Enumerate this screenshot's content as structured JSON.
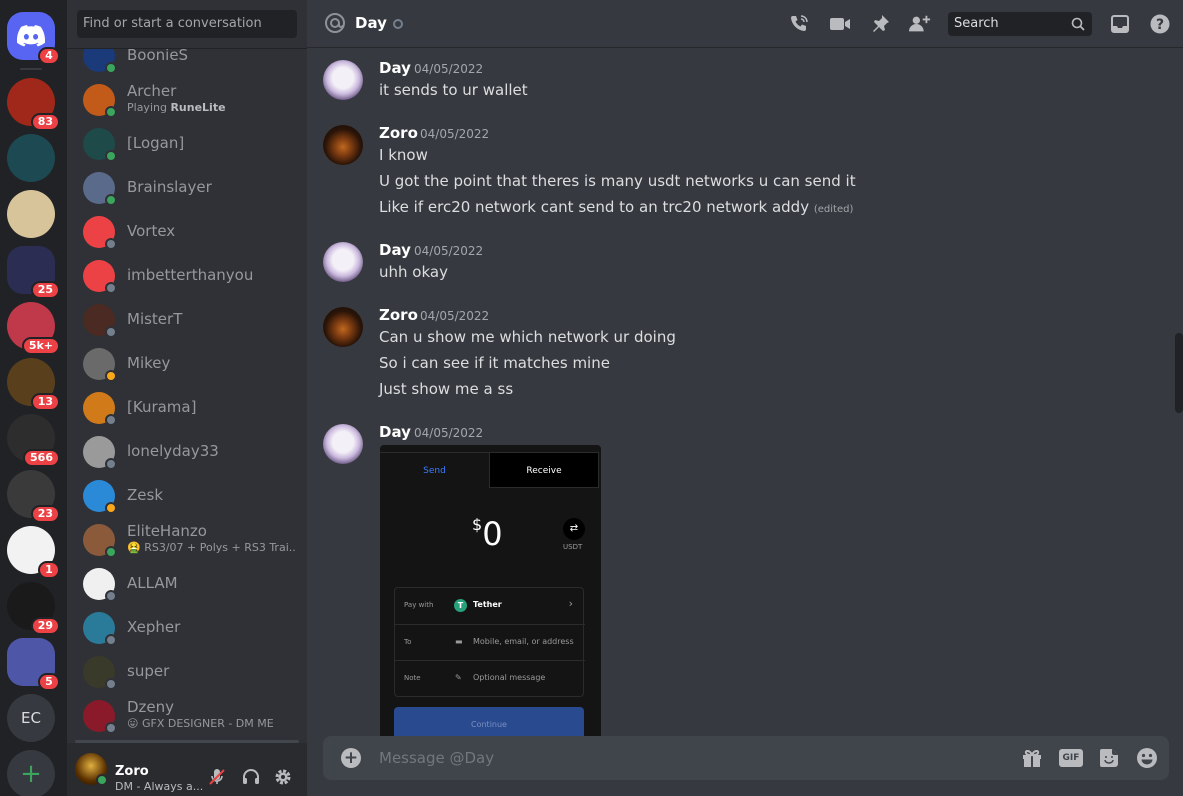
{
  "rail": {
    "servers": [
      {
        "name": "home",
        "badge": "4",
        "color": "#5865f2"
      },
      {
        "name": "server-kc",
        "badge": "83",
        "color": "#a0281a"
      },
      {
        "name": "server-king-of-stakes",
        "badge": "",
        "color": "#1d4a52"
      },
      {
        "name": "server-sythe",
        "badge": "",
        "color": "#d8c49a"
      },
      {
        "name": "server-s",
        "badge": "25",
        "color": "#2b2d52"
      },
      {
        "name": "server-crown",
        "badge": "5k+",
        "color": "#c0394a"
      },
      {
        "name": "server-stake",
        "badge": "13",
        "color": "#5a3f1c"
      },
      {
        "name": "server-ninja",
        "badge": "566",
        "color": "#2d2d2d"
      },
      {
        "name": "server-eternal",
        "badge": "23",
        "color": "#3a3a3a"
      },
      {
        "name": "server-equine",
        "badge": "1",
        "color": "#f2f2f2"
      },
      {
        "name": "server-zi",
        "badge": "29",
        "color": "#1a1a1a"
      },
      {
        "name": "server-purple",
        "badge": "5",
        "color": "#4e56a8"
      }
    ],
    "ec_label": "EC",
    "add_label": "+"
  },
  "dm_search": {
    "placeholder": "Find or start a conversation"
  },
  "dms": [
    {
      "name": "BoonieS",
      "sub": "",
      "status": "online",
      "color": "#1a3a7a"
    },
    {
      "name": "Archer",
      "sub_prefix": "Playing ",
      "sub_bold": "RuneLite",
      "status": "online",
      "color": "#c25a1a"
    },
    {
      "name": "[Logan]",
      "sub": "",
      "status": "online",
      "color": "#1f4a4a"
    },
    {
      "name": "Brainslayer",
      "sub": "",
      "status": "online",
      "color": "#5a6a8a"
    },
    {
      "name": "Vortex",
      "sub": "",
      "status": "offline",
      "color": "#ed4245"
    },
    {
      "name": "imbetterthanyou",
      "sub": "",
      "status": "offline",
      "color": "#ed4245"
    },
    {
      "name": "MisterT",
      "sub": "",
      "status": "offline",
      "color": "#4a2a22"
    },
    {
      "name": "Mikey",
      "sub": "",
      "status": "idle",
      "color": "#6a6a6a"
    },
    {
      "name": "[Kurama]",
      "sub": "",
      "status": "offline",
      "color": "#d07a1a"
    },
    {
      "name": "lonelyday33",
      "sub": "",
      "status": "offline",
      "color": "#9a9a9a"
    },
    {
      "name": "Zesk",
      "sub": "",
      "status": "idle",
      "color": "#2b8ad8"
    },
    {
      "name": "EliteHanzo",
      "sub": "🤮 RS3/07 + Polys + RS3 Trai...",
      "status": "online",
      "color": "#8a5a3a"
    },
    {
      "name": "ALLAM",
      "sub": "",
      "status": "offline",
      "color": "#f0f0f0"
    },
    {
      "name": "Xepher",
      "sub": "",
      "status": "offline",
      "color": "#2a7a9a"
    },
    {
      "name": "super",
      "sub": "",
      "status": "offline",
      "color": "#3a3a2a"
    },
    {
      "name": "Dzeny",
      "sub": "😛 GFX DESIGNER - DM ME",
      "status": "offline",
      "color": "#8a1a2a"
    }
  ],
  "user": {
    "name": "Zoro",
    "status_text": "DM - Always a..."
  },
  "header": {
    "title": "Day",
    "search_placeholder": "Search"
  },
  "messages": [
    {
      "author": "Day",
      "time": "04/05/2022",
      "avatar": "day",
      "lines": [
        "it sends to ur wallet"
      ]
    },
    {
      "author": "Zoro",
      "time": "04/05/2022",
      "avatar": "zoro",
      "lines": [
        "I know",
        "U got the point that theres is many usdt networks u can send it",
        "Like if erc20 network cant send to an trc20 network addy"
      ],
      "edited_label": "(edited)"
    },
    {
      "author": "Day",
      "time": "04/05/2022",
      "avatar": "day",
      "lines": [
        "uhh okay"
      ]
    },
    {
      "author": "Zoro",
      "time": "04/05/2022",
      "avatar": "zoro",
      "lines": [
        "Can u show me which network ur doing",
        "So i can see if it matches mine",
        "Just show me a ss"
      ]
    },
    {
      "author": "Day",
      "time": "04/05/2022",
      "avatar": "day",
      "lines": []
    }
  ],
  "attachment": {
    "tab_send": "Send",
    "tab_receive": "Receive",
    "amount_symbol": "$",
    "amount": "0",
    "currency": "USDT",
    "pay_with_label": "Pay with",
    "pay_with_value": "Tether",
    "to_label": "To",
    "to_placeholder": "Mobile, email, or address",
    "note_label": "Note",
    "note_placeholder": "Optional message",
    "continue_label": "Continue"
  },
  "composer": {
    "placeholder": "Message @Day",
    "gif_label": "GIF"
  }
}
